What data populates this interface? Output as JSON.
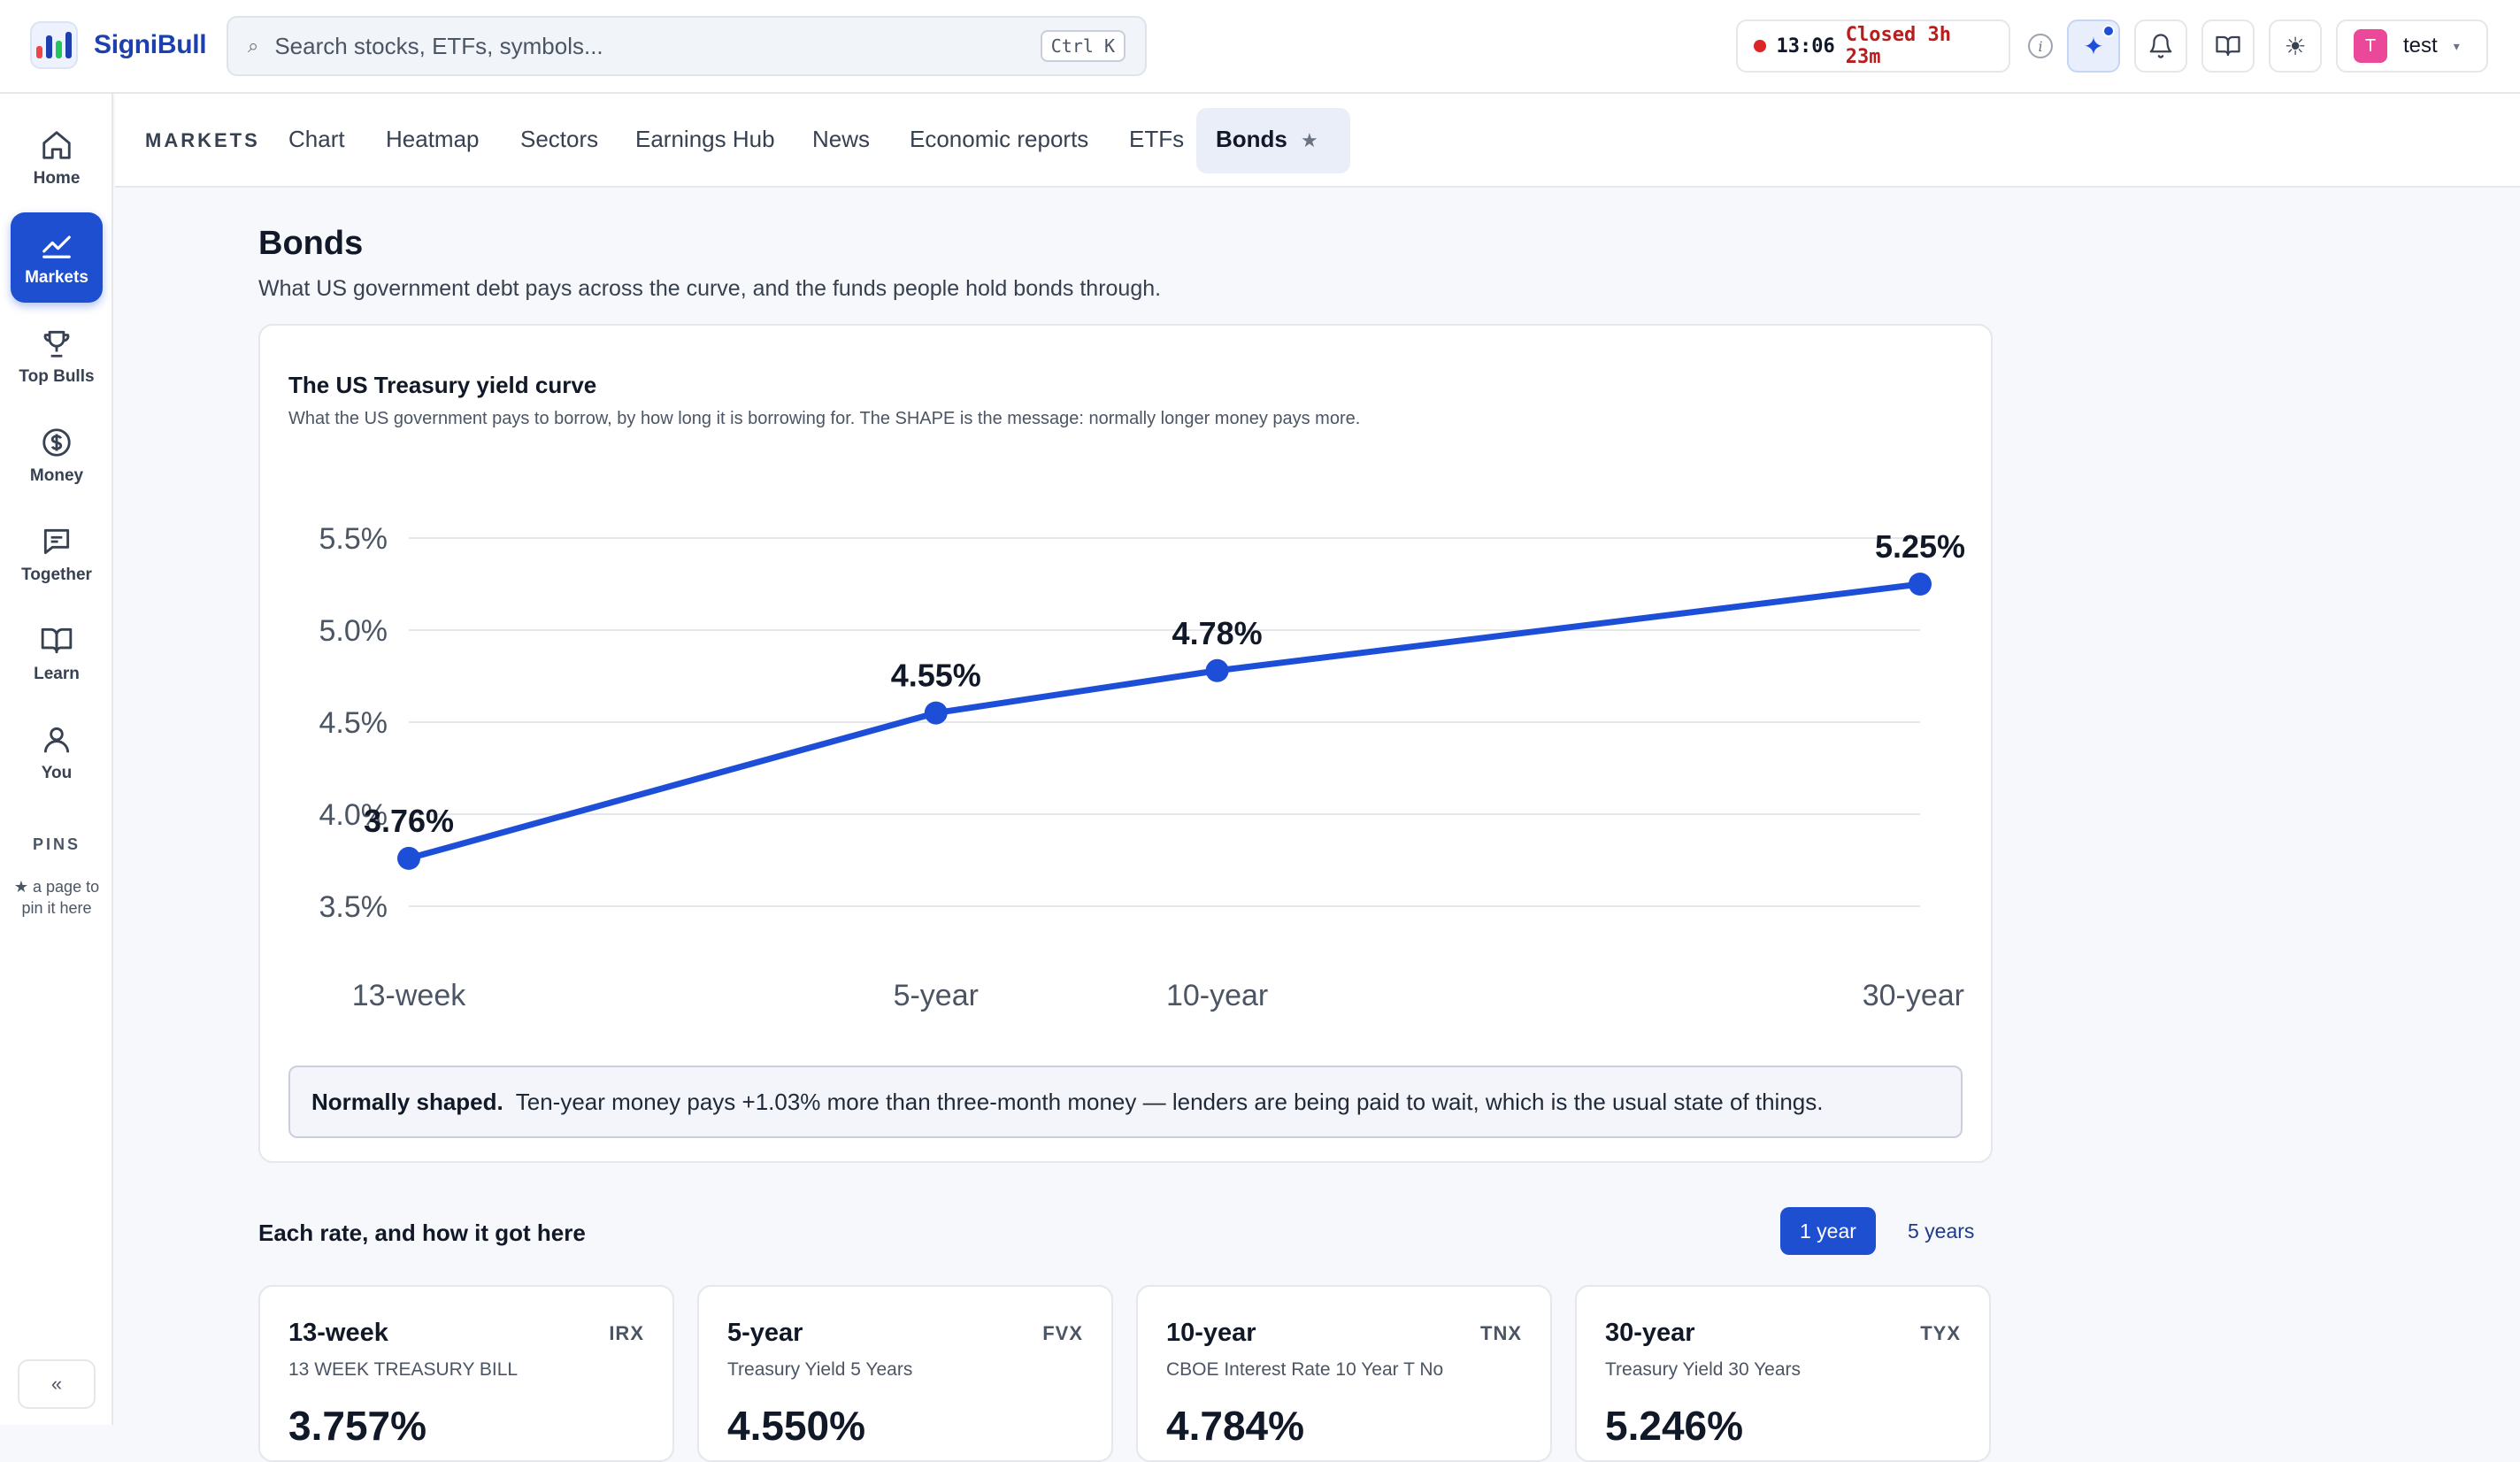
{
  "app": {
    "name_part1": "Signi",
    "name_part2": "Bull",
    "search_placeholder": "Search stocks, ETFs, symbols...",
    "search_shortcut": "Ctrl K",
    "market_time": "13:06",
    "market_status": "Closed 3h 23m",
    "user_initial": "T",
    "user_name": "test"
  },
  "rail": {
    "items": [
      {
        "label": "Home",
        "icon": "home-icon"
      },
      {
        "label": "Markets",
        "icon": "chart-line-icon"
      },
      {
        "label": "Top Bulls",
        "icon": "trophy-icon"
      },
      {
        "label": "Money",
        "icon": "coin-icon"
      },
      {
        "label": "Together",
        "icon": "chat-icon"
      },
      {
        "label": "Learn",
        "icon": "book-icon"
      },
      {
        "label": "You",
        "icon": "user-icon"
      }
    ],
    "pins_title": "PINS",
    "pins_hint": "★ a page to pin it here",
    "collapse": "«"
  },
  "subnav": {
    "title": "MARKETS",
    "tabs": [
      "Chart",
      "Heatmap",
      "Sectors",
      "Earnings Hub",
      "News",
      "Economic reports",
      "ETFs",
      "Bonds"
    ],
    "active_tab": "Bonds",
    "star": "★"
  },
  "page": {
    "title": "Bonds",
    "subtitle": "What US government debt pays across the curve, and the funds people hold bonds through."
  },
  "curve": {
    "title": "The US Treasury yield curve",
    "subtitle": "What the US government pays to borrow, by how long it is borrowing for. The SHAPE is the message: normally longer money pays more.",
    "note_bold": "Normally shaped.",
    "note_text": "Ten-year money pays +1.03% more than three-month money — lenders are being paid to wait, which is the usual state of things."
  },
  "chart_data": {
    "type": "line",
    "x_years": [
      0.25,
      5,
      10,
      30
    ],
    "x_labels": [
      "13-week",
      "5-year",
      "10-year",
      "30-year"
    ],
    "values": [
      3.76,
      4.55,
      4.78,
      5.25
    ],
    "point_labels": [
      "3.76%",
      "4.55%",
      "4.78%",
      "5.25%"
    ],
    "yticks": [
      3.5,
      4.0,
      4.5,
      5.0,
      5.5
    ],
    "ytick_labels": [
      "3.5%",
      "4.0%",
      "4.5%",
      "5.0%",
      "5.5%"
    ],
    "ylim": [
      3.5,
      5.5
    ],
    "x_scale": "sqrt",
    "grid": true,
    "color": "#1d4ed8"
  },
  "rates": {
    "section_title": "Each rate, and how it got here",
    "range_options": [
      "1 year",
      "5 years"
    ],
    "active_range": "1 year",
    "cards": [
      {
        "term": "13-week",
        "symbol": "IRX",
        "name": "13 WEEK TREASURY BILL",
        "value": "3.757%"
      },
      {
        "term": "5-year",
        "symbol": "FVX",
        "name": "Treasury Yield 5 Years",
        "value": "4.550%"
      },
      {
        "term": "10-year",
        "symbol": "TNX",
        "name": "CBOE Interest Rate 10 Year T No",
        "value": "4.784%"
      },
      {
        "term": "30-year",
        "symbol": "TYX",
        "name": "Treasury Yield 30 Years",
        "value": "5.246%"
      }
    ]
  }
}
